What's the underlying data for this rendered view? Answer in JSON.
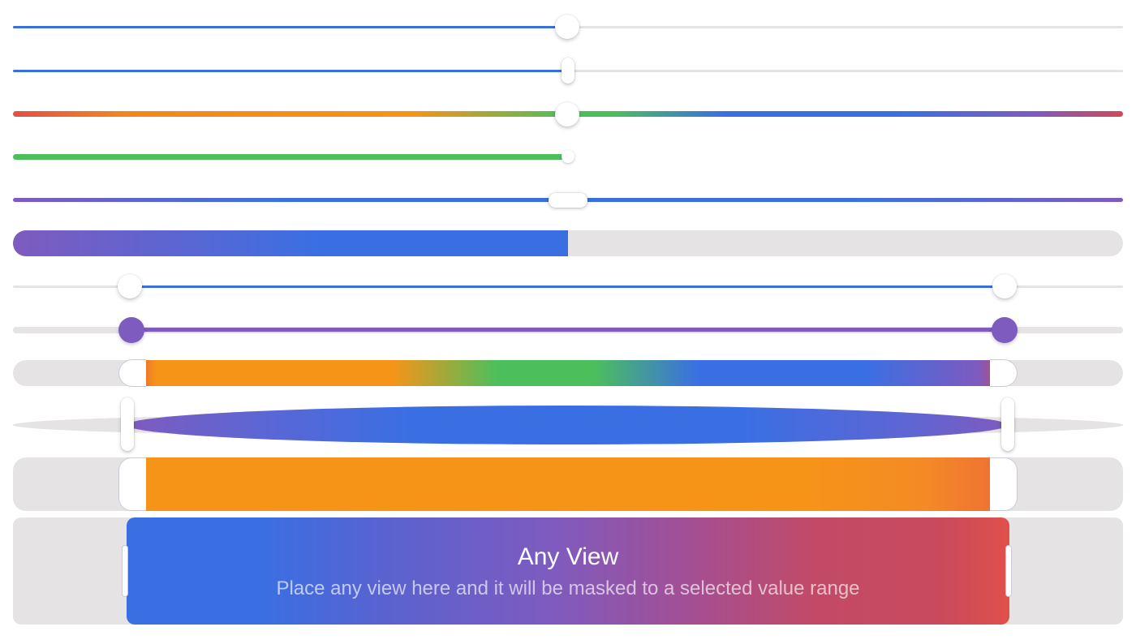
{
  "sliders": [
    {
      "id": "single-blue-round",
      "value": 0.5
    },
    {
      "id": "single-blue-pill",
      "value": 0.5
    },
    {
      "id": "single-rainbow-round",
      "value": 0.5
    },
    {
      "id": "single-green-small",
      "value": 0.5
    },
    {
      "id": "single-purple-blue-pill",
      "value": 0.5
    },
    {
      "id": "progress-purple-blue",
      "value": 0.5
    },
    {
      "id": "range-blue-round",
      "lower": 0.105,
      "upper": 0.895
    },
    {
      "id": "range-purple",
      "lower": 0.105,
      "upper": 0.895
    },
    {
      "id": "range-rainbow-bar",
      "lower": 0.105,
      "upper": 0.895
    },
    {
      "id": "range-lens-blue",
      "lower": 0.105,
      "upper": 0.895
    },
    {
      "id": "range-orange-block",
      "lower": 0.105,
      "upper": 0.895
    },
    {
      "id": "range-any-view",
      "lower": 0.1,
      "upper": 0.9
    }
  ],
  "colors": {
    "blue": "#3a6fe3",
    "track": "#e5e3e3",
    "green": "#4cbf5c",
    "orange": "#f69418",
    "purple": "#7e5bbf",
    "red": "#c94a5d"
  },
  "any_view": {
    "title": "Any View",
    "subtitle": "Place any view here and it will be masked to a selected value range"
  }
}
